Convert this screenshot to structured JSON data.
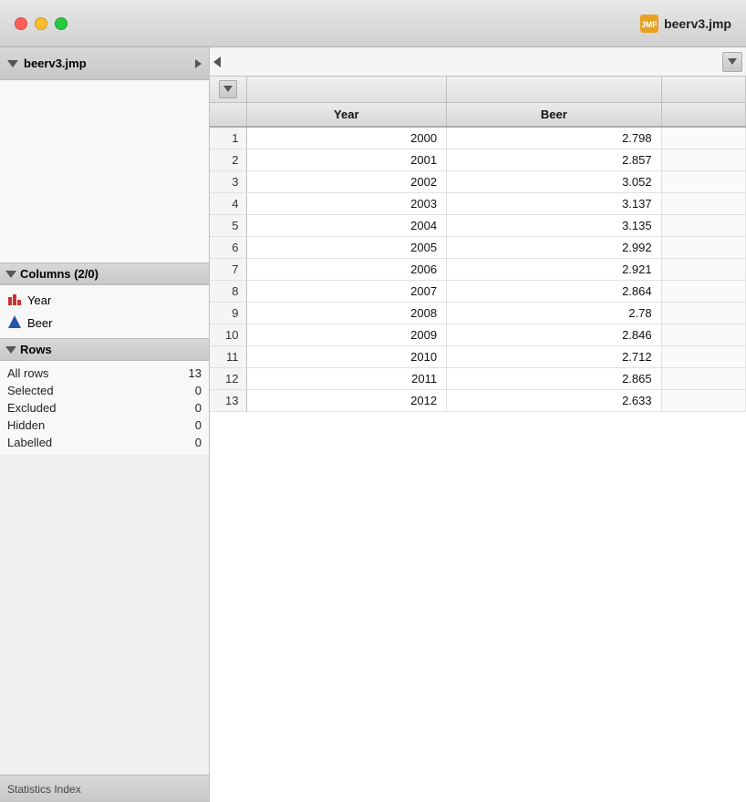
{
  "titlebar": {
    "title": "beerv3.jmp",
    "close_label": "close",
    "minimize_label": "minimize",
    "maximize_label": "maximize"
  },
  "datasource": {
    "label": "beerv3.jmp",
    "arrow_label": "navigate"
  },
  "columns": {
    "header": "Columns (2/0)",
    "items": [
      {
        "name": "Year",
        "type": "bar"
      },
      {
        "name": "Beer",
        "type": "triangle"
      }
    ]
  },
  "rows": {
    "header": "Rows",
    "items": [
      {
        "label": "All rows",
        "value": "13"
      },
      {
        "label": "Selected",
        "value": "0"
      },
      {
        "label": "Excluded",
        "value": "0"
      },
      {
        "label": "Hidden",
        "value": "0"
      },
      {
        "label": "Labelled",
        "value": "0"
      }
    ]
  },
  "bottom_bar": {
    "label": "Statistics Index"
  },
  "table": {
    "columns": [
      "Year",
      "Beer"
    ],
    "rows": [
      {
        "row": 1,
        "year": 2000,
        "beer": "2.798"
      },
      {
        "row": 2,
        "year": 2001,
        "beer": "2.857"
      },
      {
        "row": 3,
        "year": 2002,
        "beer": "3.052"
      },
      {
        "row": 4,
        "year": 2003,
        "beer": "3.137"
      },
      {
        "row": 5,
        "year": 2004,
        "beer": "3.135"
      },
      {
        "row": 6,
        "year": 2005,
        "beer": "2.992"
      },
      {
        "row": 7,
        "year": 2006,
        "beer": "2.921"
      },
      {
        "row": 8,
        "year": 2007,
        "beer": "2.864"
      },
      {
        "row": 9,
        "year": 2008,
        "beer": "2.78"
      },
      {
        "row": 10,
        "year": 2009,
        "beer": "2.846"
      },
      {
        "row": 11,
        "year": 2010,
        "beer": "2.712"
      },
      {
        "row": 12,
        "year": 2011,
        "beer": "2.865"
      },
      {
        "row": 13,
        "year": 2012,
        "beer": "2.633"
      }
    ]
  }
}
